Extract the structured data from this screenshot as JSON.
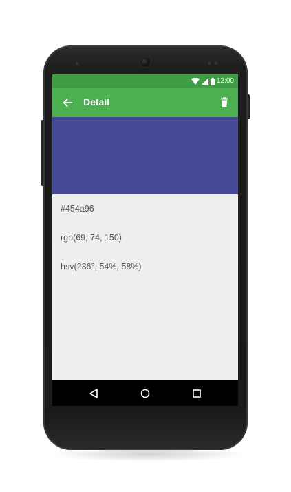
{
  "status_bar": {
    "time": "12:00",
    "icons": [
      "wifi-icon",
      "signal-icon",
      "battery-icon"
    ]
  },
  "toolbar": {
    "title": "Detail",
    "back_icon": "arrow-left-icon",
    "delete_icon": "trash-icon",
    "background_color": "#4caf50",
    "status_color": "#3f9e45"
  },
  "color_detail": {
    "swatch_color": "#454a96",
    "hex": "#454a96",
    "rgb": "rgb(69, 74, 150)",
    "hsv": "hsv(236°, 54%, 58%)"
  },
  "nav_bar": {
    "buttons": [
      "back-triangle-icon",
      "home-circle-icon",
      "recents-square-icon"
    ]
  }
}
